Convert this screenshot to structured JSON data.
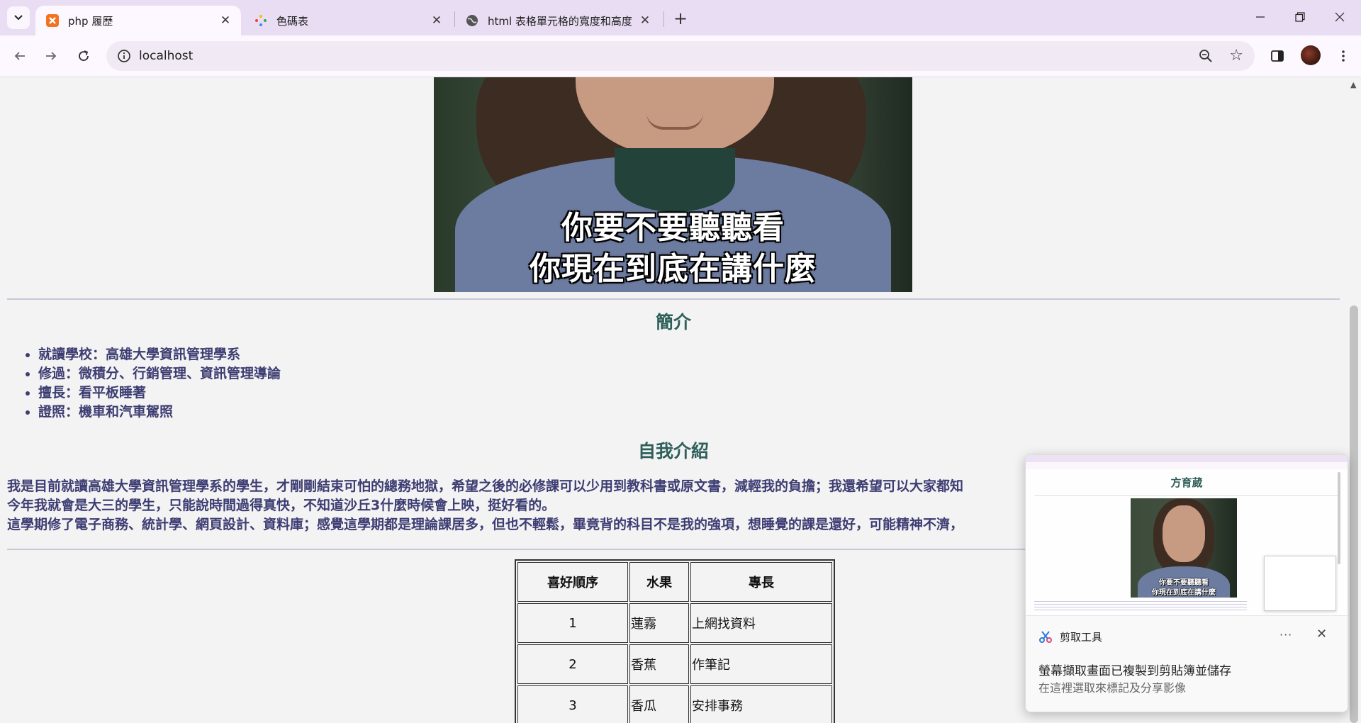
{
  "browser": {
    "tabs": [
      {
        "title": "php 履歷",
        "active": true
      },
      {
        "title": "色碼表",
        "active": false
      },
      {
        "title": "html 表格單元格的寬度和高度",
        "active": false
      }
    ],
    "url": "localhost"
  },
  "page": {
    "photo_subtitles": [
      "你要不要聽聽看",
      "你現在到底在講什麼"
    ],
    "intro_heading": "簡介",
    "skills": [
      "就讀學校：高雄大學資訊管理學系",
      "修過：微積分、行銷管理、資訊管理導論",
      "擅長：看平板睡著",
      "證照：機車和汽車駕照"
    ],
    "self_heading": "自我介紹",
    "self_paragraphs": [
      "我是目前就讀高雄大學資訊管理學系的學生，才剛剛結束可怕的總務地獄，希望之後的必修課可以少用到教科書或原文書，減輕我的負擔；我還希望可以大家都知",
      "今年我就會是大三的學生，只能說時間過得真快，不知道沙丘3什麼時候會上映，挺好看的。",
      "這學期修了電子商務、統計學、網頁設計、資料庫；感覺這學期都是理論課居多，但也不輕鬆，畢竟背的科目不是我的強項，想睡覺的課是還好，可能精神不濟，"
    ],
    "table": {
      "headers": [
        "喜好順序",
        "水果",
        "專長"
      ],
      "rows": [
        [
          "1",
          "蓮霧",
          "上網找資料"
        ],
        [
          "2",
          "香蕉",
          "作筆記"
        ],
        [
          "3",
          "香瓜",
          "安排事務"
        ]
      ]
    }
  },
  "toast": {
    "preview_title": "方育葳",
    "preview_subtitles": [
      "你要不要聽聽看",
      "你現在到底在講什麼"
    ],
    "app_name": "剪取工具",
    "more": "···",
    "message": "螢幕擷取畫面已複製到剪貼簿並儲存",
    "sub_message": "在這裡選取來標記及分享影像"
  },
  "colors": {
    "heading": "#2e5f5a",
    "body_text": "#3d3d73",
    "tab_bar": "#e9ddf3"
  }
}
